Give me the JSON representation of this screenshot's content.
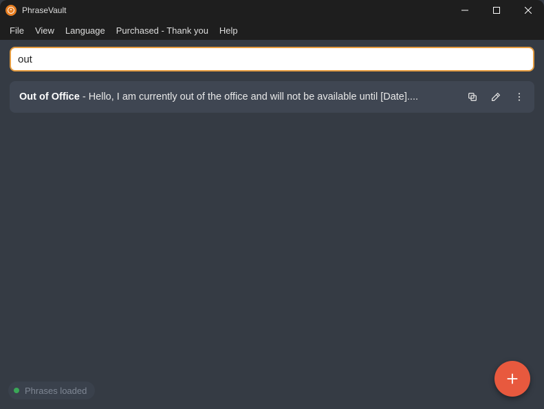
{
  "titlebar": {
    "app_name": "PhraseVault"
  },
  "menubar": {
    "items": [
      "File",
      "View",
      "Language",
      "Purchased - Thank you",
      "Help"
    ]
  },
  "search": {
    "value": "out",
    "placeholder": ""
  },
  "results": [
    {
      "title": "Out of Office",
      "separator": " - ",
      "snippet": "Hello, I am currently out of the office and will not be available until [Date]...."
    }
  ],
  "status": {
    "text": "Phrases loaded"
  }
}
